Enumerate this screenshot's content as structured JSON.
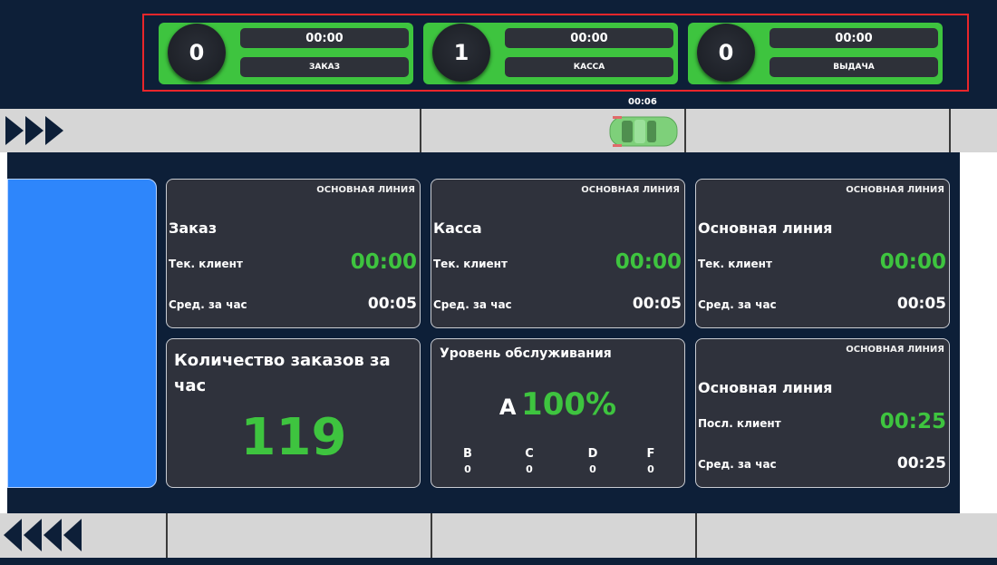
{
  "stations": [
    {
      "count": "0",
      "time": "00:00",
      "label": "ЗАКАЗ"
    },
    {
      "count": "1",
      "time": "00:00",
      "label": "КАССА"
    },
    {
      "count": "0",
      "time": "00:00",
      "label": "ВЫДАЧА"
    }
  ],
  "car": {
    "time": "00:06",
    "icon": "car-icon",
    "color": "#7ed07a"
  },
  "cards": {
    "order": {
      "tag": "ОСНОВНАЯ ЛИНИЯ",
      "title": "Заказ",
      "row1_label": "Тек. клиент",
      "row1_value": "00:00",
      "row2_label": "Сред. за час",
      "row2_value": "00:05"
    },
    "cashier": {
      "tag": "ОСНОВНАЯ ЛИНИЯ",
      "title": "Касса",
      "row1_label": "Тек. клиент",
      "row1_value": "00:00",
      "row2_label": "Сред. за час",
      "row2_value": "00:05"
    },
    "main": {
      "tag": "ОСНОВНАЯ ЛИНИЯ",
      "title": "Основная линия",
      "row1_label": "Тек. клиент",
      "row1_value": "00:00",
      "row2_label": "Сред. за час",
      "row2_value": "00:05"
    },
    "count": {
      "title": "Количество заказов за час",
      "value": "119"
    },
    "service": {
      "title": "Уровень обслуживания",
      "grade": "A",
      "percent": "100%",
      "grades": [
        {
          "g": "B",
          "n": "0"
        },
        {
          "g": "C",
          "n": "0"
        },
        {
          "g": "D",
          "n": "0"
        },
        {
          "g": "F",
          "n": "0"
        }
      ]
    },
    "last": {
      "tag": "ОСНОВНАЯ ЛИНИЯ",
      "title": "Основная линия",
      "row1_label": "Посл. клиент",
      "row1_value": "00:25",
      "row2_label": "Сред. за час",
      "row2_value": "00:25"
    }
  },
  "colors": {
    "background": "#0d1f38",
    "accent_green": "#3ec43f",
    "highlight_red": "#e8262b",
    "blue_card": "#2e86fb"
  }
}
